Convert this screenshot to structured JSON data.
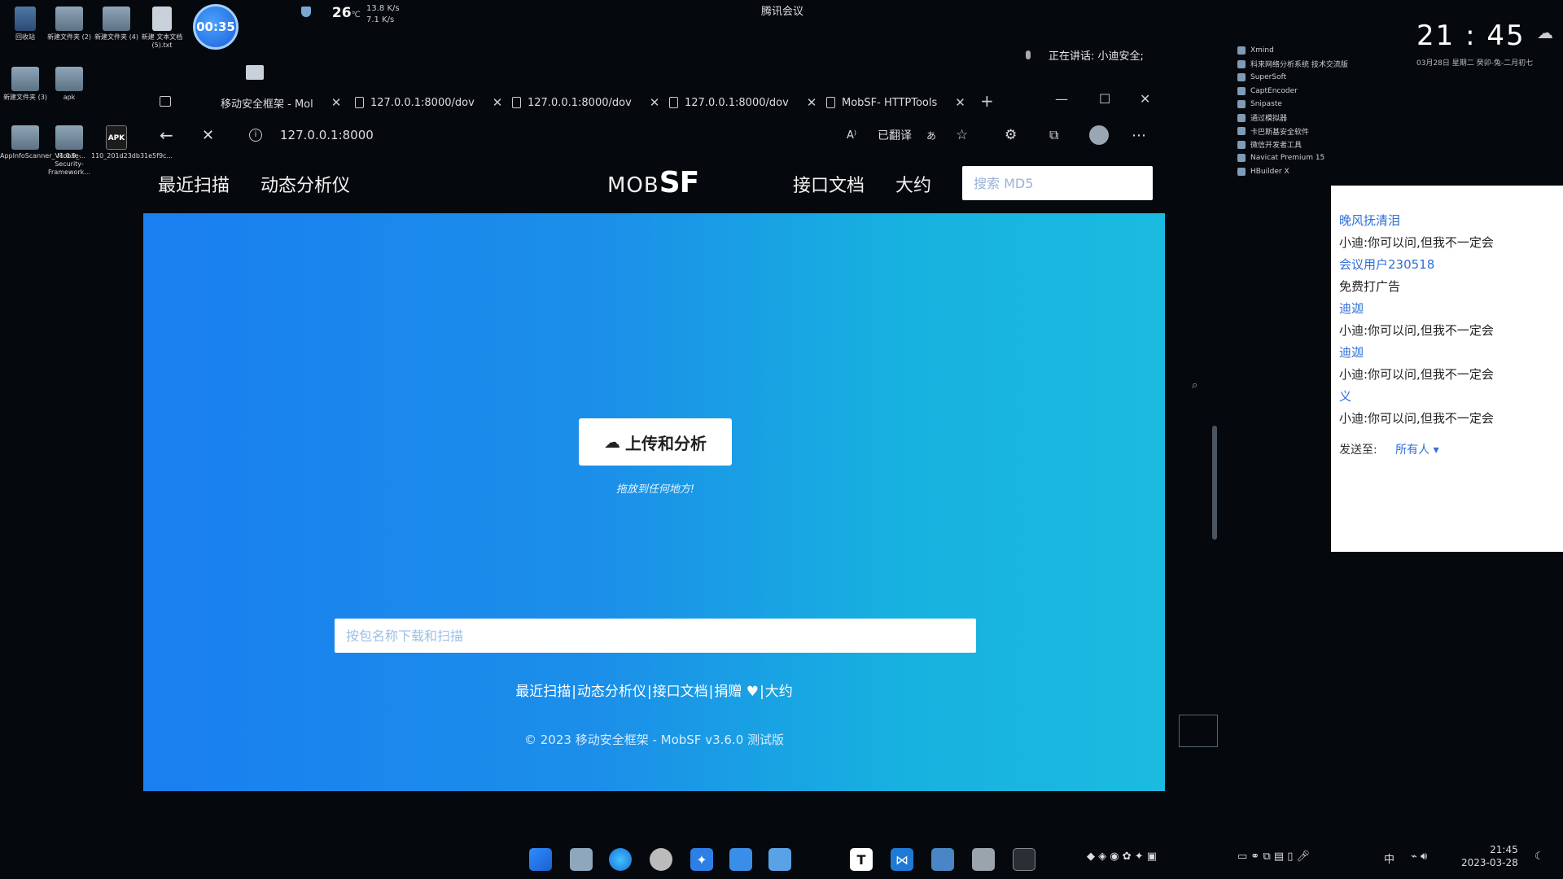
{
  "desktop": {
    "icons": [
      {
        "label": "回收站"
      },
      {
        "label": "新建文件夹 (2)"
      },
      {
        "label": "新建文件夹 (4)"
      },
      {
        "label": "新建 文本文档 (5).txt"
      },
      {
        "label": "新建文件夹 (3)"
      },
      {
        "label": "apk"
      },
      {
        "label": "AppInfoScanner_V1.0.9_..."
      },
      {
        "label": "Mobile-Security-Framework..."
      },
      {
        "label": "110_201d23db31e5f9c..."
      }
    ],
    "timer": "00:35",
    "weather_temp": "26",
    "weather_unit": "℃",
    "net_up": "13.8 K/s",
    "net_down": "7.1 K/s",
    "meeting_title": "腾讯会议",
    "speaking": "正在讲话: 小迪安全;"
  },
  "browser": {
    "tabs": [
      {
        "label": "移动安全框架 - Mol"
      },
      {
        "label": "127.0.0.1:8000/dov"
      },
      {
        "label": "127.0.0.1:8000/dov"
      },
      {
        "label": "127.0.0.1:8000/dov"
      },
      {
        "label": "MobSF- HTTPTools"
      }
    ],
    "url": "127.0.0.1:8000",
    "translated": "已翻译"
  },
  "page": {
    "nav": {
      "recent_scans": "最近扫描",
      "dynamic_analyzer": "动态分析仪",
      "api_docs": "接口文档",
      "about": "大约",
      "search_placeholder": "搜索 MD5"
    },
    "logo_prefix": "MOB",
    "logo_suffix": "SF",
    "upload_button": "上传和分析",
    "drop_hint": "拖放到任何地方!",
    "package_placeholder": "按包名称下载和扫描",
    "footer_links": [
      "最近扫描",
      "动态分析仪",
      "接口文档",
      "捐赠 ♥",
      "大约"
    ],
    "copyright": "© 2023 移动安全框架 - MobSF v3.6.0 测试版"
  },
  "launcher": {
    "items": [
      "Xmind",
      "科来网络分析系统 技术交流版",
      "SuperSoft",
      "CaptEncoder",
      "Snipaste",
      "通过模拟器",
      "卡巴斯基安全软件",
      "微信开发者工具",
      "Navicat Premium 15",
      "HBuilder X"
    ]
  },
  "clock": {
    "time": "21 : 45",
    "date": "03月28日  星期二  癸卯-兔-二月初七"
  },
  "chat": {
    "messages": [
      {
        "user": "晚风抚清泪",
        "text": "小迪:你可以问,但我不一定会"
      },
      {
        "user": "会议用户230518",
        "text": "免费打广告"
      },
      {
        "user": "迪迦",
        "text": "小迪:你可以问,但我不一定会"
      },
      {
        "user": "迪迦",
        "text": "小迪:你可以问,但我不一定会"
      },
      {
        "user": "义",
        "text": "小迪:你可以问,但我不一定会"
      }
    ],
    "send_to_label": "发送至:",
    "send_to_value": "所有人 ▾"
  },
  "taskbar": {
    "ime": "中",
    "time": "21:45",
    "date": "2023-03-28"
  }
}
